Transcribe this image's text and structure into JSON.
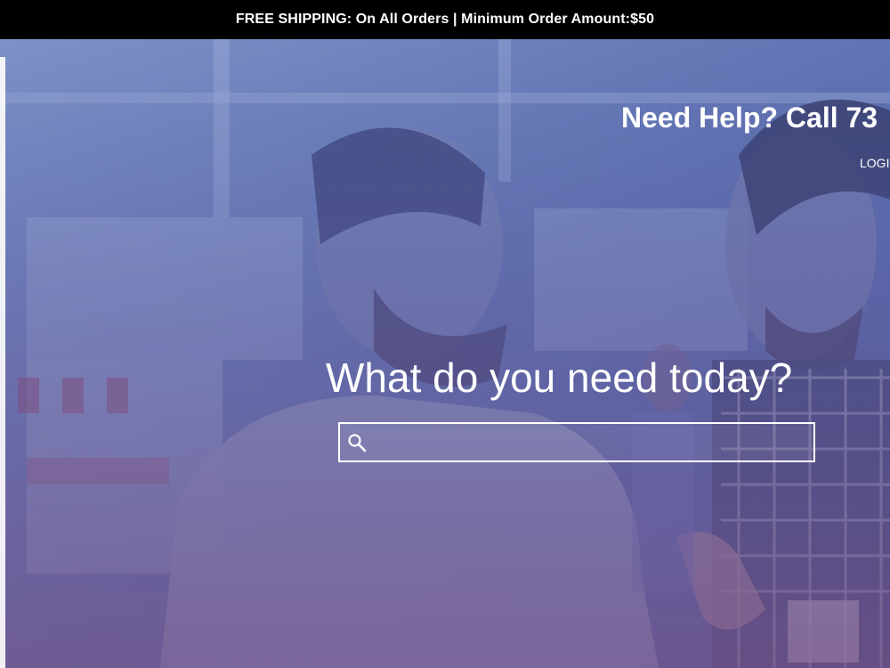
{
  "announcement": {
    "text": "FREE SHIPPING: On All Orders | Minimum Order Amount:$50"
  },
  "header": {
    "help_text": "Need Help? Call 73",
    "login_label": "LOGI"
  },
  "hero": {
    "headline": "What do you need today?",
    "search": {
      "value": "",
      "placeholder": "",
      "icon": "search-icon"
    }
  },
  "colors": {
    "topbar_bg": "#000000",
    "text_on_hero": "#ffffff",
    "hero_tint": "#5c6fa8"
  }
}
